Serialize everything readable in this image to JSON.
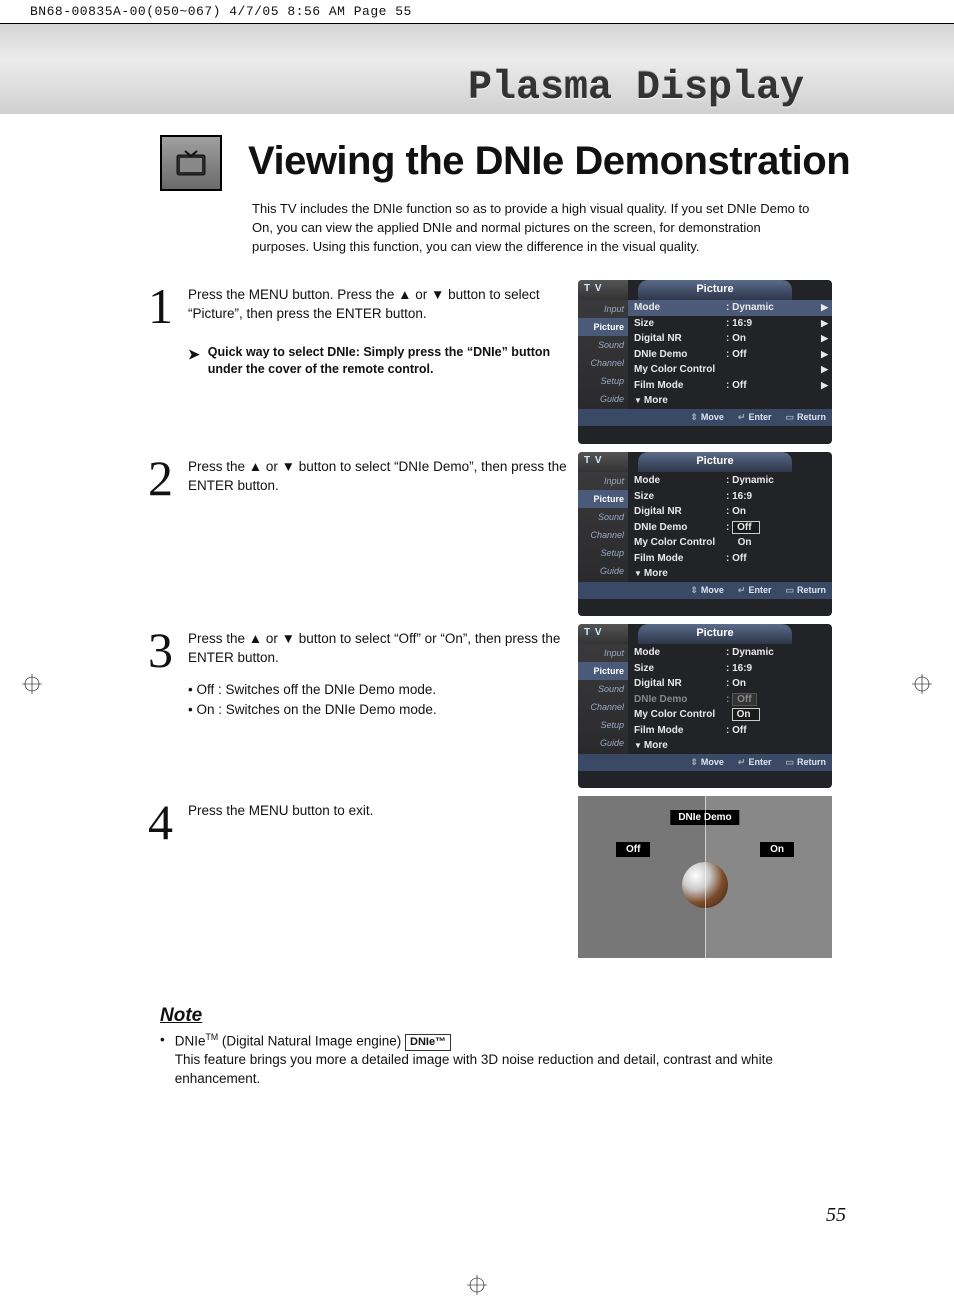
{
  "printer_mark": "BN68-00835A-00(050~067)  4/7/05  8:56 AM  Page 55",
  "header": {
    "plasma": "Plasma Display",
    "title": "Viewing the DNIe Demonstration",
    "intro": "This TV includes the DNIe function so as to provide a high visual quality.\nIf you set DNIe Demo to On, you can view the applied DNIe and normal pictures on the screen, for demonstration purposes. Using this function, you can view the difference in the visual quality."
  },
  "steps": [
    {
      "num": "1",
      "text": "Press the MENU button. Press the ▲ or ▼ button to select “Picture”, then press the ENTER button.",
      "quick": "Quick way to select DNIe: Simply press the “DNIe” button under the cover of the remote control."
    },
    {
      "num": "2",
      "text": "Press the ▲ or ▼ button to select “DNIe Demo”, then press the ENTER button."
    },
    {
      "num": "3",
      "text": "Press the ▲ or ▼ button to select “Off” or “On”, then press the ENTER button.",
      "bullets": [
        "Off : Switches off the DNIe Demo mode.",
        "On : Switches on the DNIe Demo mode."
      ]
    },
    {
      "num": "4",
      "text": "Press the MENU button to exit."
    }
  ],
  "osd": {
    "tv": "T V",
    "tab": "Picture",
    "side": [
      "Input",
      "Picture",
      "Sound",
      "Channel",
      "Setup",
      "Guide"
    ],
    "rows": [
      {
        "label": "Mode",
        "value": ": Dynamic",
        "arrow": true
      },
      {
        "label": "Size",
        "value": ": 16:9",
        "arrow": true
      },
      {
        "label": "Digital NR",
        "value": ": On",
        "arrow": true
      },
      {
        "label": "DNIe Demo",
        "value": ": Off",
        "arrow": true
      },
      {
        "label": "My Color Control",
        "value": "",
        "arrow": true
      },
      {
        "label": "Film Mode",
        "value": ": Off",
        "arrow": true
      }
    ],
    "more": "More",
    "bottom": {
      "move": "Move",
      "enter": "Enter",
      "ret": "Return"
    },
    "options": {
      "off": "Off",
      "on": "On"
    }
  },
  "demo": {
    "title": "DNIe Demo",
    "off": "Off",
    "on": "On"
  },
  "note": {
    "heading": "Note",
    "line1a": "DNIe",
    "line1b": " (Digital Natural Image engine) ",
    "badge": "DNIe™",
    "line2": "This feature brings you more a detailed image with 3D noise reduction and detail, contrast and white enhancement."
  },
  "page_num": "55"
}
